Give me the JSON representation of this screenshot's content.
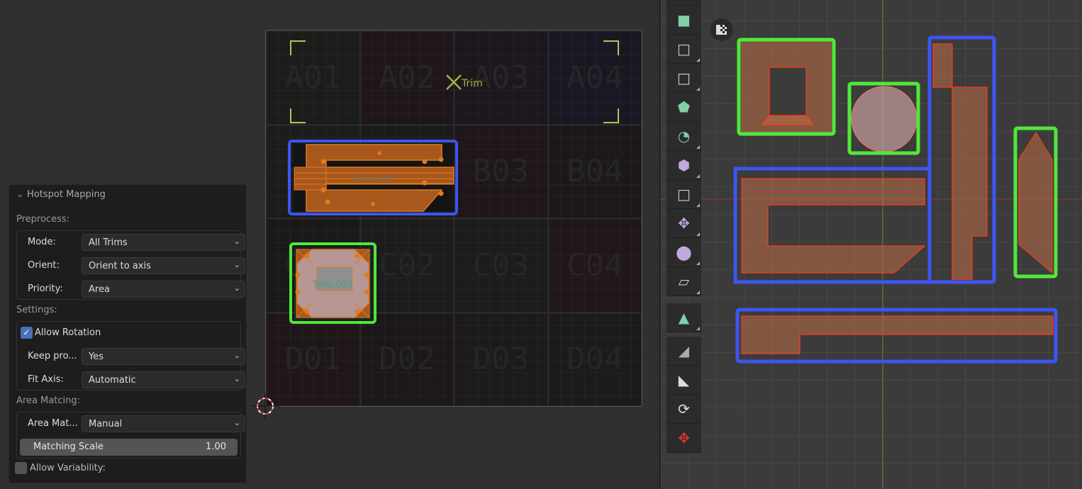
{
  "panel": {
    "title": "Hotspot Mapping",
    "preprocess_label": "Preprocess:",
    "mode": {
      "label": "Mode:",
      "value": "All Trims"
    },
    "orient": {
      "label": "Orient:",
      "value": "Orient to axis"
    },
    "priority": {
      "label": "Priority:",
      "value": "Area"
    },
    "settings_label": "Settings:",
    "allow_rotation": {
      "label": "Allow Rotation",
      "checked": true
    },
    "keep_proportions": {
      "label": "Keep pro...",
      "value": "Yes"
    },
    "fit_axis": {
      "label": "Fit Axis:",
      "value": "Automatic"
    },
    "area_matching_label": "Area Matcing:",
    "area_matching": {
      "label": "Area Mat...",
      "value": "Manual"
    },
    "matching_scale": {
      "label": "Matching Scale",
      "value": "1.00"
    },
    "allow_variability": {
      "label": "Allow Variability:",
      "checked": false
    }
  },
  "texture": {
    "cells": [
      "A01",
      "A02",
      "A03",
      "A04",
      "B01",
      "B02",
      "B03",
      "B04",
      "C01",
      "C02",
      "C03",
      "C04",
      "D01",
      "D02",
      "D03",
      "D04"
    ]
  },
  "trims": {
    "trim": "Trim",
    "trim001": "Trim.001",
    "trim002": "Trim.002"
  },
  "colors": {
    "trim_blue": "#3d55f0",
    "trim_green": "#4fe93a",
    "uv_orange": "#c86a1e",
    "edge_red": "#ff3b1a",
    "accent": "#4772b3"
  },
  "toolbar": {
    "icons": [
      "extrude-region-icon",
      "inset-faces-icon",
      "bevel-icon",
      "loop-cut-icon",
      "knife-icon",
      "poly-build-icon",
      "spin-icon",
      "smooth-icon",
      "edge-slide-icon",
      "shrink-fatten-icon",
      "shear-icon",
      "rip-region-icon",
      "annotate-icon",
      "measure-icon",
      "hotspot-icon",
      "transform-icon"
    ]
  }
}
